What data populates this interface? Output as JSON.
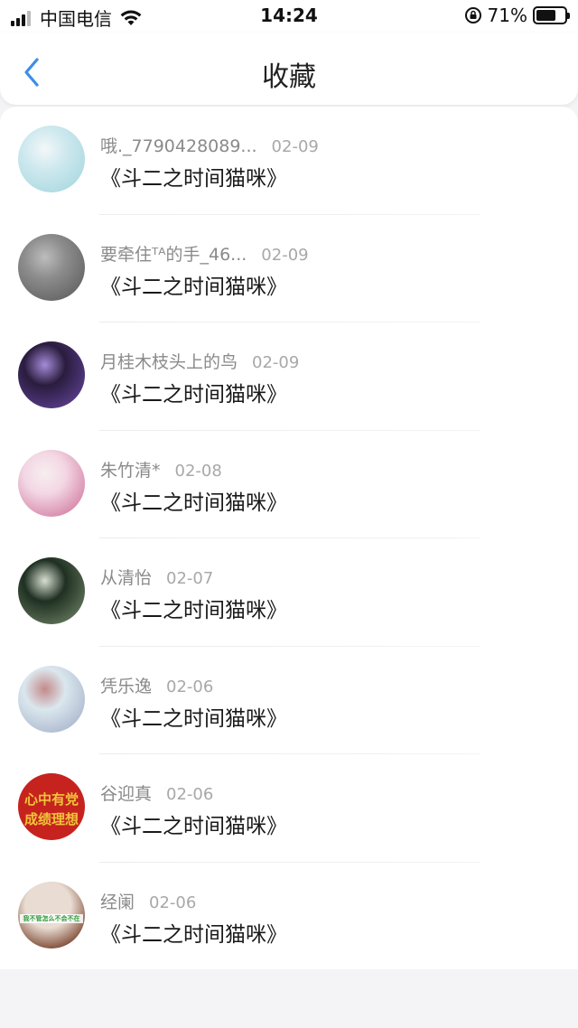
{
  "status_bar": {
    "carrier": "中国电信",
    "time": "14:24",
    "battery_percent": "71%",
    "battery_level": 0.71
  },
  "nav": {
    "title": "收藏",
    "back_icon": "chevron-left-icon",
    "accent": "#3b8ee8"
  },
  "items": [
    {
      "username": "哦._7790428089...",
      "date": "02-09",
      "title": "《斗二之时间猫咪》",
      "avatar_colors": [
        "#cfe9ef",
        "#9fd4dc",
        "#f3f7f8"
      ]
    },
    {
      "username": "要牵住ᵀᴬ的手_46...",
      "date": "02-09",
      "title": "《斗二之时间猫咪》",
      "avatar_colors": [
        "#8d8d8d",
        "#555555",
        "#bdbdbd"
      ]
    },
    {
      "username": "月桂木枝头上的鸟",
      "date": "02-09",
      "title": "《斗二之时间猫咪》",
      "avatar_colors": [
        "#2a1c3e",
        "#6b4aa8",
        "#a58cd8"
      ]
    },
    {
      "username": "朱竹清*",
      "date": "02-08",
      "title": "《斗二之时间猫咪》",
      "avatar_colors": [
        "#f3d7e4",
        "#c9658f",
        "#f7eef0"
      ]
    },
    {
      "username": "从清怡",
      "date": "02-07",
      "title": "《斗二之时间猫咪》",
      "avatar_colors": [
        "#1f3022",
        "#7a8f6e",
        "#d8dfd2"
      ]
    },
    {
      "username": "凭乐逸",
      "date": "02-06",
      "title": "《斗二之时间猫咪》",
      "avatar_colors": [
        "#dbe7ee",
        "#9aa7c2",
        "#c48a8a"
      ]
    },
    {
      "username": "谷迎真",
      "date": "02-06",
      "title": "《斗二之时间猫咪》",
      "avatar_colors": [
        "#c6231e",
        "#a5160f",
        "#f0c43a"
      ],
      "avatar_text": [
        "心中有党",
        "成绩理想"
      ]
    },
    {
      "username": "经阑",
      "date": "02-06",
      "title": "《斗二之时间猫咪》",
      "avatar_colors": [
        "#e9ddd3",
        "#8a5a46",
        "#2f9b3c"
      ],
      "avatar_text": [
        "我不管怎么不会不在"
      ]
    }
  ]
}
